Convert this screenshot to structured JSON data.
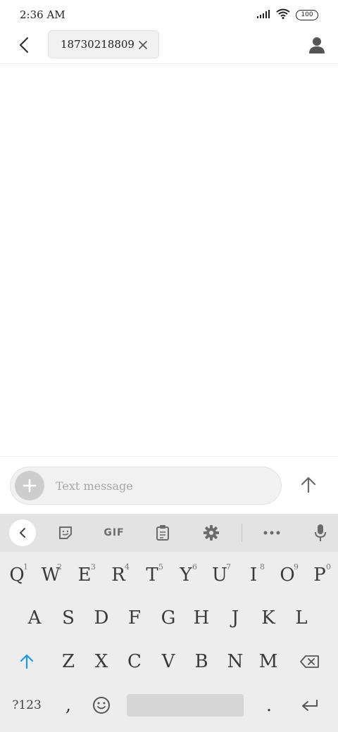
{
  "status_bar": {
    "time": "2:36 AM",
    "battery": "100",
    "icons": [
      "signal-icon",
      "wifi-icon",
      "battery-icon"
    ]
  },
  "header": {
    "recipient": "18730218809",
    "icons": [
      "back-arrow-icon",
      "close-icon",
      "contact-person-icon"
    ]
  },
  "compose": {
    "placeholder": "Text message",
    "value": "",
    "icons": [
      "plus-icon",
      "send-arrow-up-icon"
    ]
  },
  "keyboard": {
    "toolbar_gif": "GIF",
    "toolbar_icons": [
      "chevron-left-icon",
      "sticker-icon",
      "gif-icon",
      "clipboard-icon",
      "settings-gear-icon",
      "more-dots-icon",
      "microphone-icon"
    ],
    "rows": [
      {
        "keys": [
          {
            "label": "Q",
            "hint": "1"
          },
          {
            "label": "W",
            "hint": "2"
          },
          {
            "label": "E",
            "hint": "3"
          },
          {
            "label": "R",
            "hint": "4"
          },
          {
            "label": "T",
            "hint": "5"
          },
          {
            "label": "Y",
            "hint": "6"
          },
          {
            "label": "U",
            "hint": "7"
          },
          {
            "label": "I",
            "hint": "8"
          },
          {
            "label": "O",
            "hint": "9"
          },
          {
            "label": "P",
            "hint": "0"
          }
        ]
      },
      {
        "keys": [
          {
            "label": "A"
          },
          {
            "label": "S"
          },
          {
            "label": "D"
          },
          {
            "label": "F"
          },
          {
            "label": "G"
          },
          {
            "label": "H"
          },
          {
            "label": "J"
          },
          {
            "label": "K"
          },
          {
            "label": "L"
          }
        ]
      },
      {
        "keys": [
          {
            "label": "Z"
          },
          {
            "label": "X"
          },
          {
            "label": "C"
          },
          {
            "label": "V"
          },
          {
            "label": "B"
          },
          {
            "label": "N"
          },
          {
            "label": "M"
          }
        ]
      }
    ],
    "symbols_key": "?123",
    "comma_key": ",",
    "period_key": ".",
    "special_icons": [
      "shift-arrow-icon",
      "backspace-icon",
      "emoji-icon",
      "enter-icon"
    ]
  },
  "colors": {
    "accent": "#2196f3",
    "chip_bg": "#f1f1f1",
    "keyboard_bg": "#ededed",
    "toolbar_bg": "#e3e3e3"
  }
}
